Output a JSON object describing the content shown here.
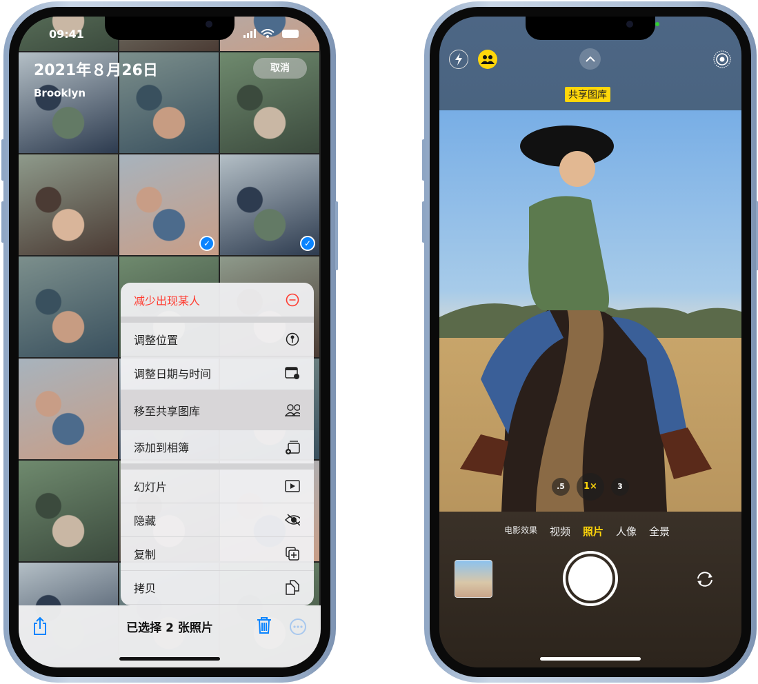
{
  "left_phone": {
    "status": {
      "time": "09:41"
    },
    "header": {
      "date": "2021年８月26日",
      "location": "Brooklyn",
      "cancel_label": "取消"
    },
    "photos": [
      {
        "selected": false
      },
      {
        "selected": false
      },
      {
        "selected": false
      },
      {
        "selected": false
      },
      {
        "selected": false
      },
      {
        "selected": false
      },
      {
        "selected": false
      },
      {
        "selected": true
      },
      {
        "selected": true
      },
      {
        "selected": false
      },
      {
        "selected": false
      },
      {
        "selected": false
      },
      {
        "selected": false
      },
      {
        "selected": false
      },
      {
        "selected": false
      },
      {
        "selected": false
      },
      {
        "selected": false
      },
      {
        "selected": false
      },
      {
        "selected": false
      },
      {
        "selected": false
      },
      {
        "selected": false
      }
    ],
    "menu": {
      "items": [
        {
          "label": "减少出现某人",
          "icon": "minus-circle-icon"
        },
        {
          "label": "调整位置",
          "icon": "location-pin-icon"
        },
        {
          "label": "调整日期与时间",
          "icon": "calendar-clock-icon"
        },
        {
          "label": "移至共享图库",
          "icon": "people-icon"
        },
        {
          "label": "添加到相簿",
          "icon": "add-album-icon"
        },
        {
          "label": "幻灯片",
          "icon": "play-icon"
        },
        {
          "label": "隐藏",
          "icon": "eye-slash-icon"
        },
        {
          "label": "复制",
          "icon": "duplicate-icon"
        },
        {
          "label": "拷贝",
          "icon": "copy-icon"
        }
      ]
    },
    "toolbar": {
      "selection_label": "已选择 2 张照片"
    },
    "colors": {
      "accent": "#0a84ff",
      "destructive": "#ff3b30"
    }
  },
  "right_phone": {
    "shared_library_badge": "共享图库",
    "zoom_levels": [
      ".5",
      "1×",
      "3"
    ],
    "active_zoom": "1×",
    "modes": [
      "电影效果",
      "视频",
      "照片",
      "人像",
      "全景"
    ],
    "active_mode": "照片",
    "colors": {
      "highlight": "#ffd60a"
    }
  }
}
